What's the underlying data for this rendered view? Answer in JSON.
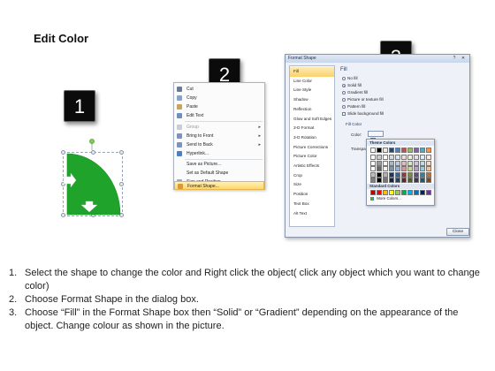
{
  "slide": {
    "title": "Edit Color",
    "steps": [
      "1",
      "2",
      "3"
    ]
  },
  "context_menu": {
    "items": [
      {
        "label": "Cut",
        "icon": "scissors-icon",
        "disabled": false,
        "submenu": false
      },
      {
        "label": "Copy",
        "icon": "copy-icon",
        "disabled": false,
        "submenu": false
      },
      {
        "label": "Paste",
        "icon": "paste-icon",
        "disabled": false,
        "submenu": false
      },
      {
        "label": "Edit Text",
        "icon": "edit-text-icon",
        "disabled": false,
        "submenu": false
      },
      {
        "label": "Group",
        "icon": "group-icon",
        "disabled": true,
        "submenu": true
      },
      {
        "label": "Bring to Front",
        "icon": "bring-front-icon",
        "disabled": false,
        "submenu": true
      },
      {
        "label": "Send to Back",
        "icon": "send-back-icon",
        "disabled": false,
        "submenu": true
      },
      {
        "label": "Hyperlink...",
        "icon": "hyperlink-icon",
        "disabled": false,
        "submenu": false
      },
      {
        "label": "Save as Picture...",
        "icon": "",
        "disabled": false,
        "submenu": false
      },
      {
        "label": "Set as Default Shape",
        "icon": "",
        "disabled": false,
        "submenu": false
      },
      {
        "label": "Size and Position...",
        "icon": "size-icon",
        "disabled": false,
        "submenu": false
      },
      {
        "label": "Format Shape...",
        "icon": "format-shape-icon",
        "disabled": false,
        "submenu": false
      }
    ]
  },
  "dialog": {
    "title": "Format Shape",
    "help_glyph": "?",
    "close_glyph": "✕",
    "nav": [
      "Fill",
      "Line Color",
      "Line Style",
      "Shadow",
      "Reflection",
      "Glow and Soft Edges",
      "3-D Format",
      "3-D Rotation",
      "Picture Corrections",
      "Picture Color",
      "Artistic Effects",
      "Crop",
      "Size",
      "Position",
      "Text Box",
      "Alt Text"
    ],
    "selected_nav": "Fill",
    "fill_heading": "Fill",
    "options": [
      {
        "label": "No fill",
        "checked": false
      },
      {
        "label": "Solid fill",
        "checked": true
      },
      {
        "label": "Gradient fill",
        "checked": false
      },
      {
        "label": "Picture or texture fill",
        "checked": false
      },
      {
        "label": "Pattern fill",
        "checked": false
      }
    ],
    "slide_bg": "Slide background fill",
    "fill_color_heading": "Fill Color",
    "color_label": "Color:",
    "transparency_label": "Transpa",
    "close_button": "Close"
  },
  "color_popup": {
    "theme_header": "Theme Colors",
    "standard_header": "Standard Colors",
    "more_colors": "More Colors...",
    "theme_top": [
      "#ffffff",
      "#000000",
      "#eeece1",
      "#1f497d",
      "#4f81bd",
      "#c0504d",
      "#9bbb59",
      "#8064a2",
      "#4bacc6",
      "#f79646"
    ],
    "standard": [
      "#c00000",
      "#ff0000",
      "#ffc000",
      "#ffff00",
      "#92d050",
      "#00b050",
      "#00b0f0",
      "#0070c0",
      "#002060",
      "#7030a0"
    ],
    "accent_shape": "#1fa32b"
  },
  "instructions": [
    {
      "num": "1.",
      "text": "Select the shape to change the color and Right click the object( click any object which you want to change color)"
    },
    {
      "num": "2.",
      "text": "Choose Format Shape in the dialog box."
    },
    {
      "num": "3.",
      "text": "Choose “Fill” in the Format Shape box then “Solid” or “Gradient” depending on the appearance of the object. Change colour as shown in the picture."
    }
  ]
}
